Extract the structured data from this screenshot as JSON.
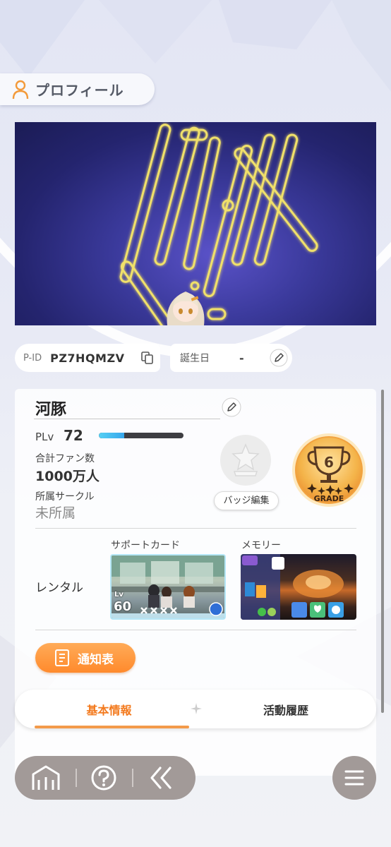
{
  "header": {
    "title": "プロフィール",
    "icon": "person-icon"
  },
  "player": {
    "pid_label": "P-ID",
    "pid": "PZ7HQMZV",
    "birthday_label": "誕生日",
    "birthday": "-",
    "name": "河豚",
    "plv_label": "PLv",
    "plv": "72",
    "plv_progress": 0.3,
    "fans_label": "合計ファン数",
    "fans": "1000万人",
    "circle_label": "所属サークル",
    "circle": "未所属"
  },
  "badge": {
    "edit_label": "バッジ編集"
  },
  "grade": {
    "number": "6",
    "label": "GRADE"
  },
  "rental": {
    "label": "レンタル",
    "support_label": "サポートカード",
    "memory_label": "メモリー",
    "support_lv_prefix": "Lv",
    "support_lv": "60"
  },
  "notice": {
    "label": "通知表"
  },
  "tabs": {
    "basic": "基本情報",
    "history": "活動履歴"
  },
  "colors": {
    "accent": "#f37a1e",
    "nav": "#a29a98",
    "banner_line": "#f0e06a"
  }
}
